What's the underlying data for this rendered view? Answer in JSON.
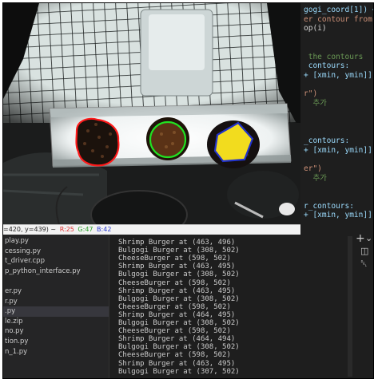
{
  "editor": {
    "lines": [
      {
        "text": "gogi_coord[1]) <=",
        "cls": "c-var"
      },
      {
        "text": "er contour from t",
        "cls": "c-str"
      },
      {
        "text": "op(i)",
        "cls": ""
      },
      {
        "text": "",
        "cls": ""
      },
      {
        "text": "",
        "cls": ""
      },
      {
        "text": " the contours",
        "cls": "c-cmt"
      },
      {
        "text": " contours:",
        "cls": "c-var"
      },
      {
        "text": "+ [xmin, ymin]],",
        "cls": "c-var"
      },
      {
        "text": "",
        "cls": ""
      },
      {
        "text": "r\")",
        "cls": "c-str"
      },
      {
        "text": "  추가",
        "cls": "c-cmt"
      },
      {
        "text": "",
        "cls": ""
      },
      {
        "text": "",
        "cls": ""
      },
      {
        "text": "",
        "cls": ""
      },
      {
        "text": "_contours:",
        "cls": "c-var"
      },
      {
        "text": "+ [xmin, ymin]],",
        "cls": "c-var"
      },
      {
        "text": "",
        "cls": ""
      },
      {
        "text": "er\")",
        "cls": "c-str"
      },
      {
        "text": "  추가",
        "cls": "c-cmt"
      },
      {
        "text": "",
        "cls": ""
      },
      {
        "text": "",
        "cls": ""
      },
      {
        "text": "r_contours:",
        "cls": "c-var"
      },
      {
        "text": "+ [xmin, ymin]],",
        "cls": "c-var"
      }
    ]
  },
  "status": {
    "coords": "=420, y=439) ~",
    "r": "R:25",
    "g": "G:47",
    "b": "B:42",
    "r_color": "#e03030",
    "g_color": "#2aa02a",
    "b_color": "#2a3ad0"
  },
  "explorer": {
    "items": [
      {
        "label": "play.py",
        "selected": false
      },
      {
        "label": "cessing.py",
        "selected": false
      },
      {
        "label": "t_driver.cpp",
        "selected": false
      },
      {
        "label": "p_python_interface.py",
        "selected": false
      },
      {
        "label": "",
        "selected": false
      },
      {
        "label": "er.py",
        "selected": false
      },
      {
        "label": "r.py",
        "selected": false
      },
      {
        "label": ".py",
        "selected": true
      },
      {
        "label": "le.zip",
        "selected": false
      },
      {
        "label": "no.py",
        "selected": false
      },
      {
        "label": "tion.py",
        "selected": false
      },
      {
        "label": "n_1.py",
        "selected": false
      }
    ]
  },
  "terminal": {
    "lines": [
      "Shrimp Burger at (463, 496)",
      "Bulgogi Burger at (308, 502)",
      "CheeseBurger at (598, 502)",
      "Shrimp Burger at (463, 495)",
      "Bulgogi Burger at (308, 502)",
      "CheeseBurger at (598, 502)",
      "Shrimp Burger at (463, 495)",
      "Bulgogi Burger at (308, 502)",
      "CheeseBurger at (598, 502)",
      "Shrimp Burger at (464, 495)",
      "Bulgogi Burger at (308, 502)",
      "CheeseBurger at (598, 502)",
      "Shrimp Burger at (464, 494)",
      "Bulgogi Burger at (308, 502)",
      "CheeseBurger at (598, 502)",
      "Shrimp Burger at (463, 495)",
      "Bulgogi Burger at (307, 502)"
    ],
    "tools": {
      "add": "+",
      "chevron": "⌄",
      "split": "◫",
      "trash": "␡"
    }
  },
  "colors": {
    "contour_red": "#ff1a1a",
    "contour_green": "#22e022",
    "contour_blue": "#2233cc",
    "fill_yellow": "#f2dc1e"
  }
}
